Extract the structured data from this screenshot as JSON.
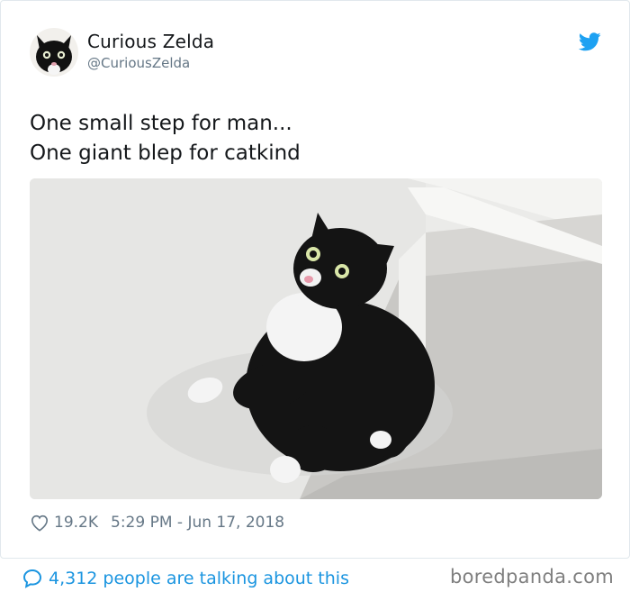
{
  "author": {
    "name": "Curious Zelda",
    "handle": "@CuriousZelda"
  },
  "tweet": {
    "lines": [
      "One small step for man...",
      "One giant blep for catkind"
    ],
    "likes": "19.2K",
    "timestamp": "5:29 PM - Jun 17, 2018"
  },
  "footer": {
    "talking": "4,312 people are talking about this"
  },
  "watermark": "boredpanda.com",
  "icons": {
    "brand": "twitter-bird-icon",
    "like": "heart-icon",
    "reply": "speech-bubble-icon"
  },
  "colors": {
    "twitter_blue": "#1b95e0",
    "secondary_text": "#657786",
    "primary_text": "#14171a"
  }
}
